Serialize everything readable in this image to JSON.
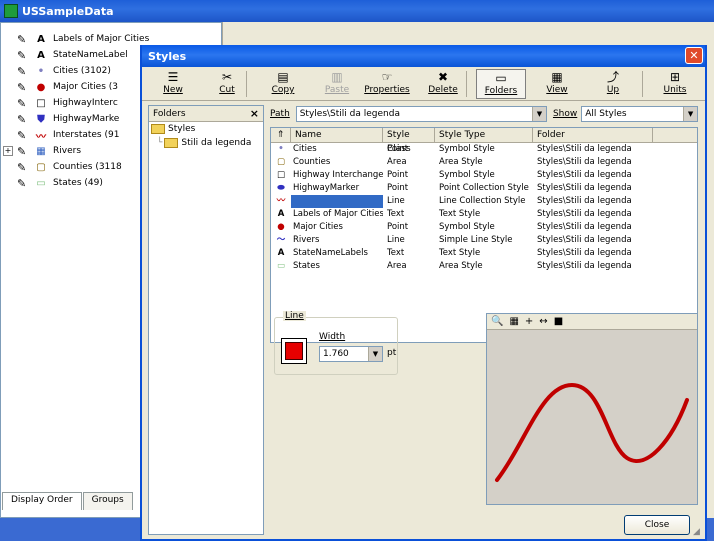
{
  "app": {
    "title": "USSampleData"
  },
  "layers": [
    {
      "label": "Labels of Major Cities",
      "sym": "A",
      "color": "#000000",
      "expander": ""
    },
    {
      "label": "StateNameLabel",
      "sym": "A",
      "color": "#000000",
      "expander": ""
    },
    {
      "label": "Cities (3102)",
      "sym": "•",
      "color": "#8080c0",
      "expander": ""
    },
    {
      "label": "Major Cities (3",
      "sym": "●",
      "color": "#c00000",
      "expander": ""
    },
    {
      "label": "HighwayInterc",
      "sym": "□",
      "color": "#000000",
      "expander": ""
    },
    {
      "label": "HighwayMarke",
      "sym": "⛊",
      "color": "#3030c0",
      "expander": ""
    },
    {
      "label": "Interstates (91",
      "sym": "〰",
      "color": "#c00000",
      "expander": ""
    },
    {
      "label": "Rivers",
      "sym": "▦",
      "color": "#3060c0",
      "expander": "+"
    },
    {
      "label": "Counties (3118",
      "sym": "▢",
      "color": "#806000",
      "expander": ""
    },
    {
      "label": "States (49)",
      "sym": "▭",
      "color": "#80c080",
      "expander": ""
    }
  ],
  "left_tabs": [
    "Display Order",
    "Groups"
  ],
  "dialog": {
    "title": "Styles",
    "close_glyph": "✕",
    "toolbar": [
      {
        "label": "New",
        "icon": "☰",
        "disabled": false,
        "pressed": false
      },
      {
        "label": "Cut",
        "icon": "✂",
        "disabled": false,
        "pressed": false
      },
      {
        "label": "Copy",
        "icon": "▤",
        "disabled": false,
        "pressed": false
      },
      {
        "label": "Paste",
        "icon": "▥",
        "disabled": true,
        "pressed": false
      },
      {
        "label": "Properties",
        "icon": "☞",
        "disabled": false,
        "pressed": false
      },
      {
        "label": "Delete",
        "icon": "✖",
        "disabled": false,
        "pressed": false
      },
      {
        "label": "Folders",
        "icon": "▭",
        "disabled": false,
        "pressed": true
      },
      {
        "label": "View",
        "icon": "▦",
        "disabled": false,
        "pressed": false
      },
      {
        "label": "Up",
        "icon": "⤴",
        "disabled": false,
        "pressed": false
      },
      {
        "label": "Units",
        "icon": "⊞",
        "disabled": false,
        "pressed": false
      }
    ],
    "folders": {
      "header": "Folders",
      "close": "×",
      "tree": [
        "Styles",
        "Stili da legenda"
      ]
    },
    "path_label": "Path",
    "path_value": "Styles\\Stili da legenda",
    "show_label": "Show",
    "show_value": "All Styles",
    "columns": [
      "Name",
      "Style Class",
      "Style Type",
      "Folder"
    ],
    "rows": [
      {
        "icon": "•",
        "icon_color": "#8080c0",
        "name": "Cities",
        "class": "Point",
        "type": "Symbol Style",
        "folder": "Styles\\Stili da legenda",
        "selected": false
      },
      {
        "icon": "▢",
        "icon_color": "#806000",
        "name": "Counties",
        "class": "Area",
        "type": "Area Style",
        "folder": "Styles\\Stili da legenda",
        "selected": false
      },
      {
        "icon": "□",
        "icon_color": "#000000",
        "name": "Highway Interchange",
        "class": "Point",
        "type": "Symbol Style",
        "folder": "Styles\\Stili da legenda",
        "selected": false
      },
      {
        "icon": "⬬",
        "icon_color": "#3030c0",
        "name": "HighwayMarker",
        "class": "Point",
        "type": "Point Collection Style",
        "folder": "Styles\\Stili da legenda",
        "selected": false
      },
      {
        "icon": "〰",
        "icon_color": "#c00000",
        "name": "",
        "class": "Line",
        "type": "Line Collection Style",
        "folder": "Styles\\Stili da legenda",
        "selected": true
      },
      {
        "icon": "A",
        "icon_color": "#000000",
        "name": "Labels of Major Cities",
        "class": "Text",
        "type": "Text Style",
        "folder": "Styles\\Stili da legenda",
        "selected": false
      },
      {
        "icon": "●",
        "icon_color": "#c00000",
        "name": "Major Cities",
        "class": "Point",
        "type": "Symbol Style",
        "folder": "Styles\\Stili da legenda",
        "selected": false
      },
      {
        "icon": "〜",
        "icon_color": "#3030c0",
        "name": "Rivers",
        "class": "Line",
        "type": "Simple Line Style",
        "folder": "Styles\\Stili da legenda",
        "selected": false
      },
      {
        "icon": "A",
        "icon_color": "#000000",
        "name": "StateNameLabels",
        "class": "Text",
        "type": "Text Style",
        "folder": "Styles\\Stili da legenda",
        "selected": false
      },
      {
        "icon": "▭",
        "icon_color": "#80c080",
        "name": "States",
        "class": "Area",
        "type": "Area Style",
        "folder": "Styles\\Stili da legenda",
        "selected": false
      }
    ],
    "line_group": {
      "legend": "Line",
      "width_label": "Width",
      "width_value": "1.760",
      "unit": "pt",
      "color": "#e60000"
    },
    "preview_tools": [
      "🔍",
      "▦",
      "+",
      "↔",
      "■"
    ],
    "preview_line_color": "#c00000",
    "close_label": "Close"
  }
}
